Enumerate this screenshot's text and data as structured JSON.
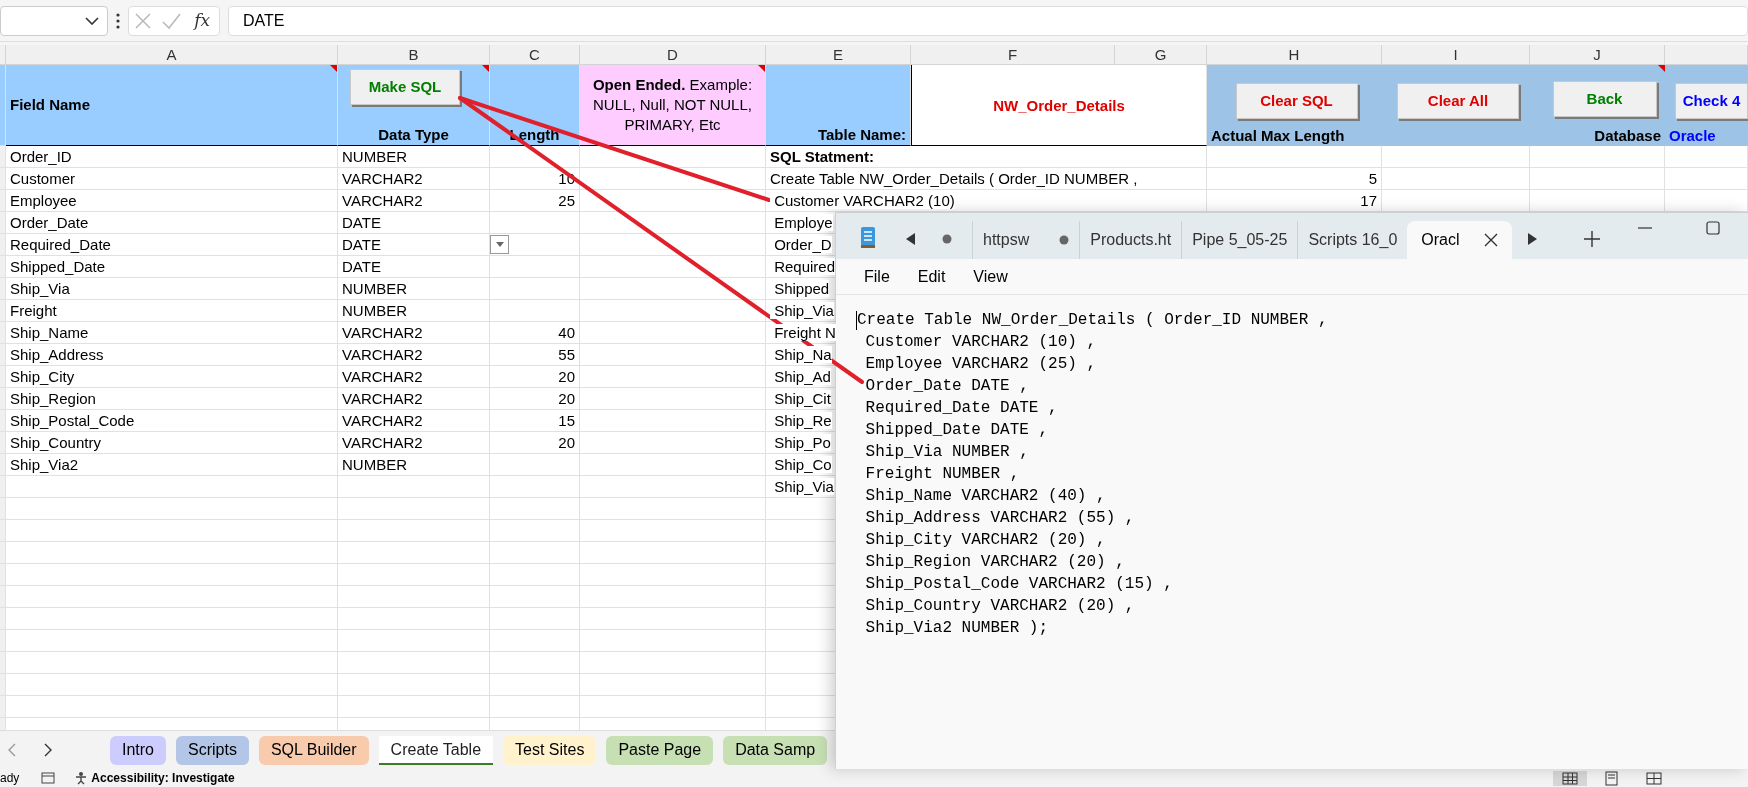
{
  "formula_bar": {
    "function_label": "fx",
    "value": "DATE"
  },
  "columns": [
    {
      "letter": "A",
      "comment": true
    },
    {
      "letter": "B",
      "comment": true
    },
    {
      "letter": "C",
      "comment": false
    },
    {
      "letter": "D",
      "comment": true
    },
    {
      "letter": "E",
      "comment": false
    },
    {
      "letter": "F",
      "comment": false
    },
    {
      "letter": "G",
      "comment": false
    },
    {
      "letter": "H",
      "comment": false
    },
    {
      "letter": "I",
      "comment": false
    },
    {
      "letter": "J",
      "comment": true
    }
  ],
  "header": {
    "field_name": "Field Name",
    "make_sql_button": "Make SQL",
    "data_type": "Data Type",
    "length": "Length",
    "open_ended": "**Open Ended.** Example: NULL, Null, NOT NULL, PRIMARY, Etc",
    "table_name_label": "Table Name:",
    "table_name": "NW_Order_Details",
    "actual_max_length": "Actual Max Length",
    "database_label": "Database",
    "database": "Oracle",
    "buttons": [
      {
        "label": "Clear SQL",
        "color": "#e00000"
      },
      {
        "label": "Clear All",
        "color": "#e00000"
      },
      {
        "label": "Back",
        "color": "#008000"
      },
      {
        "label": "Check 4",
        "color": "#0000ff"
      }
    ]
  },
  "rows": [
    {
      "field": "Order_ID",
      "type": "NUMBER",
      "dropdown_shown": false
    },
    {
      "field": "Customer",
      "type": "VARCHAR2",
      "length": "10",
      "dropdown_shown": false
    },
    {
      "field": "Employee",
      "type": "VARCHAR2",
      "length": "25",
      "dropdown_shown": false
    },
    {
      "field": "Order_Date",
      "type": "DATE",
      "dropdown_shown": false
    },
    {
      "field": "Required_Date",
      "type": "DATE",
      "dropdown_shown": true
    },
    {
      "field": "Shipped_Date",
      "type": "DATE",
      "dropdown_shown": false
    },
    {
      "field": "Ship_Via",
      "type": "NUMBER",
      "dropdown_shown": false
    },
    {
      "field": "Freight",
      "type": "NUMBER",
      "dropdown_shown": false
    },
    {
      "field": "Ship_Name",
      "type": "VARCHAR2",
      "length": "40",
      "dropdown_shown": false
    },
    {
      "field": "Ship_Address",
      "type": "VARCHAR2",
      "length": "55",
      "dropdown_shown": false
    },
    {
      "field": "Ship_City",
      "type": "VARCHAR2",
      "length": "20",
      "dropdown_shown": false
    },
    {
      "field": "Ship_Region",
      "type": "VARCHAR2",
      "length": "20",
      "dropdown_shown": false
    },
    {
      "field": "Ship_Postal_Code",
      "type": "VARCHAR2",
      "length": "15",
      "dropdown_shown": false
    },
    {
      "field": "Ship_Country",
      "type": "VARCHAR2",
      "length": "20",
      "dropdown_shown": false
    },
    {
      "field": "Ship_Via2",
      "type": "NUMBER",
      "dropdown_shown": false
    }
  ],
  "sql": {
    "heading": "SQL Statment:",
    "lines": [
      {
        "text": "Create Table NW_Order_Details ( Order_ID NUMBER ,",
        "max_length": "5"
      },
      {
        "text": " Customer VARCHAR2 (10)",
        "max_length": "17"
      },
      {
        "text": " Employe"
      },
      {
        "text": " Order_D"
      },
      {
        "text": " Required"
      },
      {
        "text": " Shipped"
      },
      {
        "text": " Ship_Via"
      },
      {
        "text": " Freight N"
      },
      {
        "text": " Ship_Na"
      },
      {
        "text": " Ship_Ad"
      },
      {
        "text": " Ship_Cit"
      },
      {
        "text": " Ship_Re"
      },
      {
        "text": " Ship_Po"
      },
      {
        "text": " Ship_Co"
      },
      {
        "text": " Ship_Via"
      }
    ]
  },
  "notepad": {
    "tabs": [
      {
        "label": "httpsw",
        "modified": true,
        "selected": false
      },
      {
        "label": "Products.ht",
        "modified": false,
        "selected": false
      },
      {
        "label": "Pipe 5_05-25",
        "modified": false,
        "selected": false
      },
      {
        "label": "Scripts 16_0",
        "modified": false,
        "selected": false
      },
      {
        "label": "Oracl",
        "modified": false,
        "selected": true
      }
    ],
    "menu": [
      "File",
      "Edit",
      "View"
    ],
    "lines": [
      "Create Table NW_Order_Details ( Order_ID NUMBER ,",
      " Customer VARCHAR2 (10) ,",
      " Employee VARCHAR2 (25) ,",
      " Order_Date DATE ,",
      " Required_Date DATE ,",
      " Shipped_Date DATE ,",
      " Ship_Via NUMBER ,",
      " Freight NUMBER ,",
      " Ship_Name VARCHAR2 (40) ,",
      " Ship_Address VARCHAR2 (55) ,",
      " Ship_City VARCHAR2 (20) ,",
      " Ship_Region VARCHAR2 (20) ,",
      " Ship_Postal_Code VARCHAR2 (15) ,",
      " Ship_Country VARCHAR2 (20) ,",
      " Ship_Via2 NUMBER );"
    ]
  },
  "sheet_tabs": [
    {
      "label": "Intro",
      "color": "#ccccff",
      "selected": false
    },
    {
      "label": "Scripts",
      "color": "#b4c6e7",
      "selected": false
    },
    {
      "label": "SQL Builder",
      "color": "#f8cbad",
      "selected": false
    },
    {
      "label": "Create Table",
      "color": "#3a7d22",
      "selected": true
    },
    {
      "label": "Test Sites",
      "color": "#fff2cc",
      "selected": false
    },
    {
      "label": "Paste Page",
      "color": "#c6e0b4",
      "selected": false
    },
    {
      "label": "Data Samp",
      "color": "#c6e0b4",
      "selected": false
    }
  ],
  "status_bar": {
    "mode": "ady",
    "accessibility": "Accessibility: Investigate"
  }
}
